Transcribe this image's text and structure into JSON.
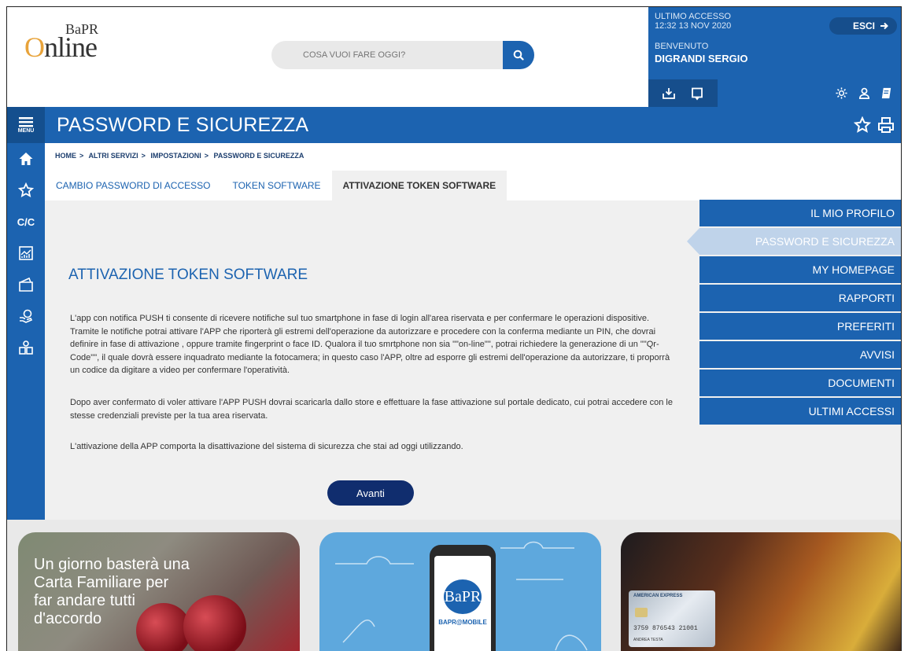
{
  "header": {
    "logo_main": "Online",
    "logo_small": "BaPR",
    "search_placeholder": "COSA VUOI FARE OGGI?"
  },
  "user": {
    "last_access_label": "ULTIMO ACCESSO",
    "last_access_value": "12:32  13 NOV 2020",
    "welcome_label": "BENVENUTO",
    "name": "DIGRANDI SERGIO",
    "logout_label": "ESCI"
  },
  "sidebar": {
    "menu_label": "MENU",
    "cc_label": "C/C"
  },
  "page": {
    "title": "PASSWORD E SICUREZZA",
    "breadcrumb": [
      "HOME",
      "ALTRI SERVIZI",
      "IMPOSTAZIONI",
      "PASSWORD E SICUREZZA"
    ],
    "tabs": [
      {
        "label": "CAMBIO PASSWORD DI ACCESSO"
      },
      {
        "label": "TOKEN SOFTWARE"
      },
      {
        "label": "ATTIVAZIONE TOKEN SOFTWARE"
      }
    ]
  },
  "main": {
    "heading": "ATTIVAZIONE TOKEN SOFTWARE",
    "paragraph_1": "L'app con notifica PUSH ti consente di ricevere notifiche sul tuo smartphone in fase di login all'area riservata e per confermare le operazioni dispositive. Tramite le notifiche potrai attivare l'APP che riporterà gli estremi dell'operazione da autorizzare e procedere con la conferma mediante un PIN, che dovrai definire in fase di attivazione , oppure tramite fingerprint o face ID. Qualora il tuo smrtphone non sia \"\"on-line\"\", potrai richiedere la generazione di un \"\"Qr-Code\"\", il quale dovrà essere inquadrato mediante la fotocamera; in questo caso l'APP, oltre ad esporre gli estremi dell'operazione da autorizzare, ti proporrà un codice da digitare a video per confermare l'operatività.",
    "paragraph_2": "Dopo aver confermato di voler attivare l'APP PUSH dovrai scaricarla dallo store e effettuare la fase attivazione sul portale dedicato, cui potrai accedere con le stesse credenziali previste per la tua area riservata.",
    "paragraph_3": "L'attivazione della APP comporta la disattivazione del sistema di sicurezza che stai ad oggi utilizzando.",
    "next_button": "Avanti"
  },
  "right_menu": [
    {
      "label": "IL MIO PROFILO"
    },
    {
      "label": "PASSWORD E SICUREZZA"
    },
    {
      "label": "MY HOMEPAGE"
    },
    {
      "label": "RAPPORTI"
    },
    {
      "label": "PREFERITI"
    },
    {
      "label": "AVVISI"
    },
    {
      "label": "DOCUMENTI"
    },
    {
      "label": "ULTIMI ACCESSI"
    }
  ],
  "banners": {
    "banner_1_text": "Un giorno basterà una Carta Familiare per far andare tutti d'accordo",
    "banner_2_logo": "BaPR",
    "banner_2_app": "BAPR@MOBILE",
    "banner_3_card_brand": "AMERICAN EXPRESS",
    "banner_3_card_number": "3759 876543 21001",
    "banner_3_card_name": "ANDREA TESTA"
  },
  "colors": {
    "primary": "#1c63b0",
    "dark_navy": "#102d6e",
    "content_bg": "#f0f0f0",
    "active_menu": "#bfd3ea"
  }
}
